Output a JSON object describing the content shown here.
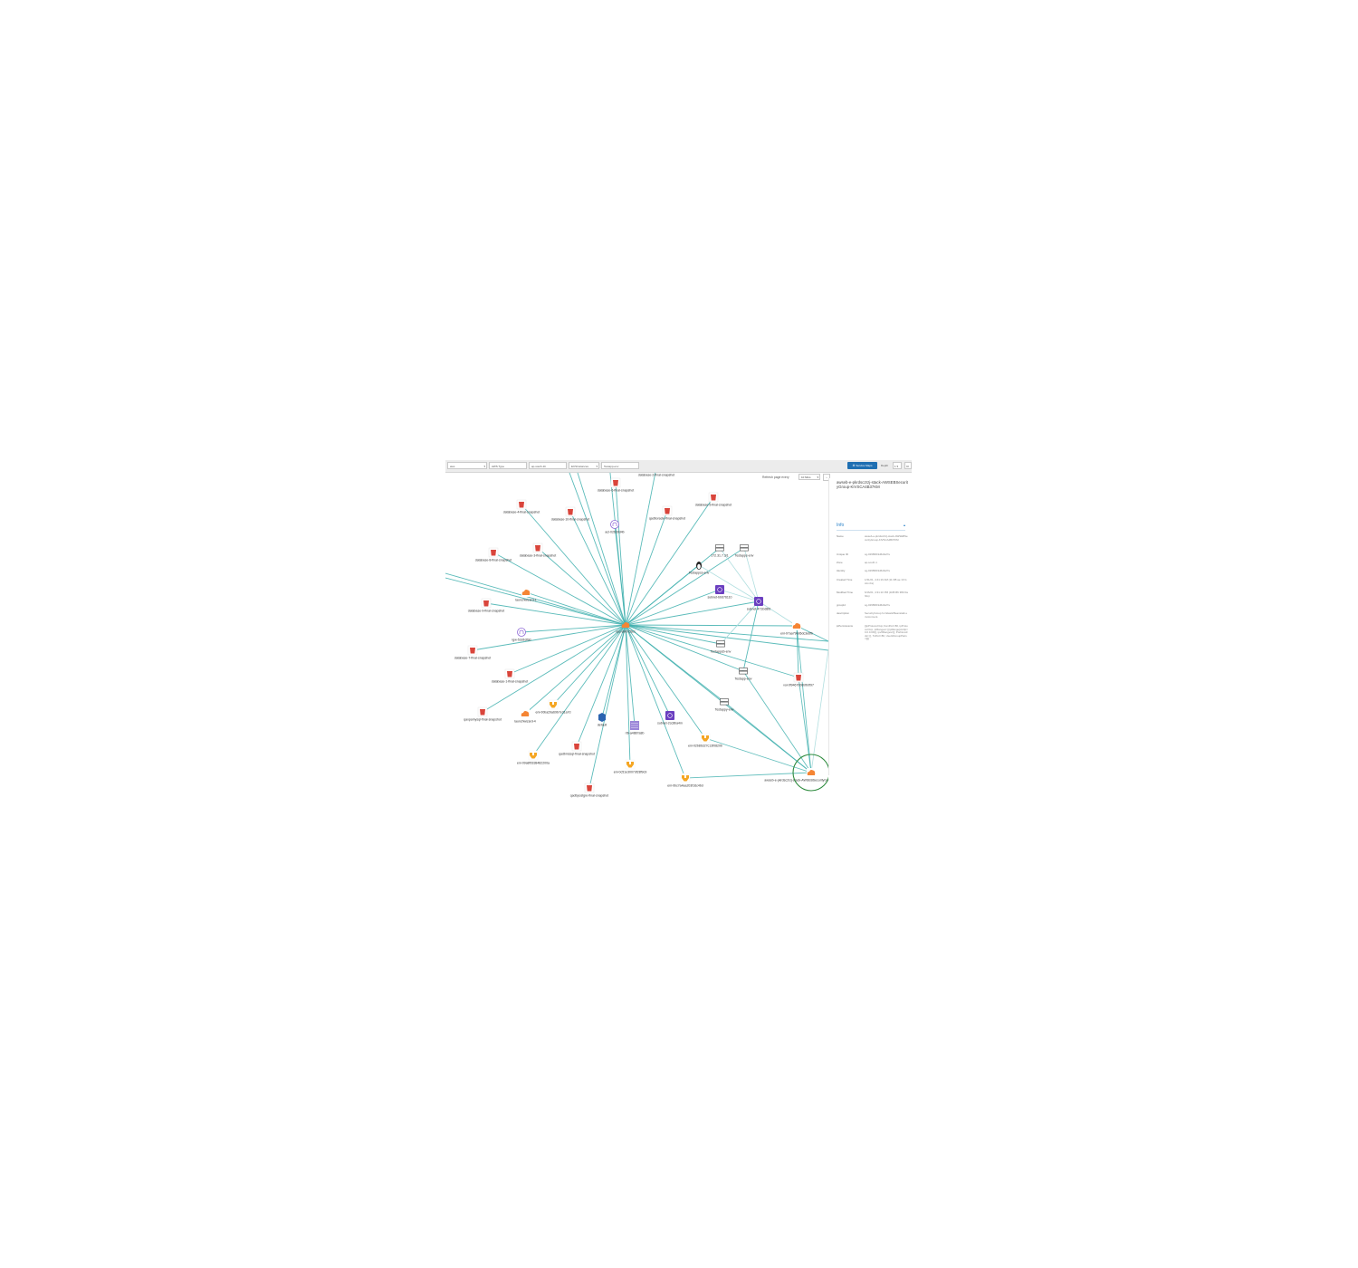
{
  "toolbar": {
    "fields": [
      {
        "value": "aws"
      },
      {
        "value": "AWS Type"
      },
      {
        "value": "ap-south-1b"
      },
      {
        "value": "ECSInstances"
      },
      {
        "value": "Testapp-env"
      }
    ],
    "service_maps_label": "Service Maps",
    "depth_label": "Depth",
    "depth_value": "1",
    "extra_button": "Cl"
  },
  "refresh": {
    "label": "Refresh page every",
    "value": "10 Mins"
  },
  "panel": {
    "title": "awseb-e-pkrdsc2rzj-stack-AWSEBSecurityGroup-KIVSCA4B37KM",
    "info_label": "Info",
    "rows": [
      {
        "k": "Name",
        "v": "awseb-e-pkrdsc2rzj-stack-AWSEBSecurityGroup-KIVSCA4B37KM"
      },
      {
        "k": "Unique ID",
        "v": "sg-02989f19d6d0ef7e"
      },
      {
        "k": "Zone",
        "v": "ap-south-1"
      },
      {
        "k": "Identity",
        "v": "sg-02989f19d6d0ef7e"
      },
      {
        "k": "Created Time",
        "v": "1/31/21, 4:41:16 AM (11 DB ae 10 GAA nbs)"
      },
      {
        "k": "Modified Time",
        "v": "6/16/21, 4:31:10 PM (1DB B6 389 Da hbs)"
      },
      {
        "k": "groupId",
        "v": "sg-02989f19d6d0ef7e"
      },
      {
        "k": "description",
        "v": "SecurityGroup for ElasticBeanstalk environment."
      },
      {
        "k": "ipPermissions",
        "v": "[{ipProtocol=tcp,fromPort=80, ipProtocol=tcp, ipRanges= [{ipRange{cidrIp=0.0.0.0/0}], ipv6Ranges=[], PrefixListIds= [], ToPort=80, UserIdGroupPairs=[]}]"
      }
    ]
  },
  "colors": {
    "edge": "#3fb0ae",
    "edge_light": "#a8dbdc",
    "rds": "#d9453b",
    "aws_orange": "#f58534",
    "vpc_purple": "#6b3fc0",
    "eni_yellow": "#f5a623",
    "selection_ring": "#2e8b3e",
    "accent_blue": "#1f6fb2"
  },
  "graph": {
    "hub": "vpc-a967c5e1",
    "nodes": [
      {
        "label": "database-6-final-snapshot",
        "icon": "rds-snapshot-icon"
      },
      {
        "label": "database-2-final-snapshot",
        "icon": "rds-snapshot-icon"
      },
      {
        "label": "database-4-final-snapshot",
        "icon": "rds-snapshot-icon"
      },
      {
        "label": "database-10-final-snapshot",
        "icon": "rds-snapshot-icon"
      },
      {
        "label": "acl-02639d4b",
        "icon": "network-acl-icon"
      },
      {
        "label": "qadboracle-final-snapshot",
        "icon": "rds-snapshot-icon"
      },
      {
        "label": "database-5-final-snapshot",
        "icon": "rds-snapshot-icon"
      },
      {
        "label": "database-8-final-snapshot",
        "icon": "rds-snapshot-icon"
      },
      {
        "label": "database-3-final-snapshot",
        "icon": "rds-snapshot-icon"
      },
      {
        "label": "172.31.7.3/1",
        "icon": "server-icon"
      },
      {
        "label": "Testapps-env",
        "icon": "server-icon"
      },
      {
        "label": "Testappss-env",
        "icon": "linux-instance-icon"
      },
      {
        "label": "launchwizard-1",
        "icon": "security-group-icon"
      },
      {
        "label": "subnet-bb676110",
        "icon": "subnet-icon"
      },
      {
        "label": "database-9-final-snapshot",
        "icon": "rds-snapshot-icon"
      },
      {
        "label": "subnet-471bd8fd",
        "icon": "subnet-icon"
      },
      {
        "label": "igw-53db3f3d",
        "icon": "internet-gateway-icon"
      },
      {
        "label": "eni-07aa790d6dc3e6fb",
        "icon": "security-group-icon"
      },
      {
        "label": "Testappsb-env",
        "icon": "server-icon"
      },
      {
        "label": "database-7-final-snapshot",
        "icon": "rds-snapshot-icon"
      },
      {
        "label": "database-1-final-snapshot",
        "icon": "rds-snapshot-icon"
      },
      {
        "label": "Testapp-env",
        "icon": "server-icon"
      },
      {
        "label": "vol-0f9467006bfb0f97",
        "icon": "rds-snapshot-icon"
      },
      {
        "label": "Testappy-env",
        "icon": "server-icon"
      },
      {
        "label": "qaxpamysql-final-snapshot",
        "icon": "rds-snapshot-icon"
      },
      {
        "label": "launchwizard-4",
        "icon": "security-group-icon"
      },
      {
        "label": "eni-00ba29a69b7e31a7d",
        "icon": "network-interface-icon"
      },
      {
        "label": "default",
        "icon": "default-sg-icon"
      },
      {
        "label": "rtb-a4887a8b",
        "icon": "route-table-icon"
      },
      {
        "label": "subnet-2cc8ba4m",
        "icon": "subnet-icon"
      },
      {
        "label": "qadbmssql-final-snapshot",
        "icon": "rds-snapshot-icon"
      },
      {
        "label": "eni-02b8b327c13f0820b",
        "icon": "network-interface-icon"
      },
      {
        "label": "eni-09a8f0338482200a",
        "icon": "network-interface-icon"
      },
      {
        "label": "eni-0c51e3007df28f9c9",
        "icon": "network-interface-icon"
      },
      {
        "label": "eni-0bc7a4aa203f16c4bd",
        "icon": "network-interface-icon"
      },
      {
        "label": "qadbpostgre-final-snapshot",
        "icon": "rds-snapshot-icon"
      },
      {
        "label": "awseb-e-pkrdsc2rzj-stack-AWSEBSecurityGroup-KIVSCA4B37KM",
        "icon": "security-group-icon"
      }
    ]
  }
}
